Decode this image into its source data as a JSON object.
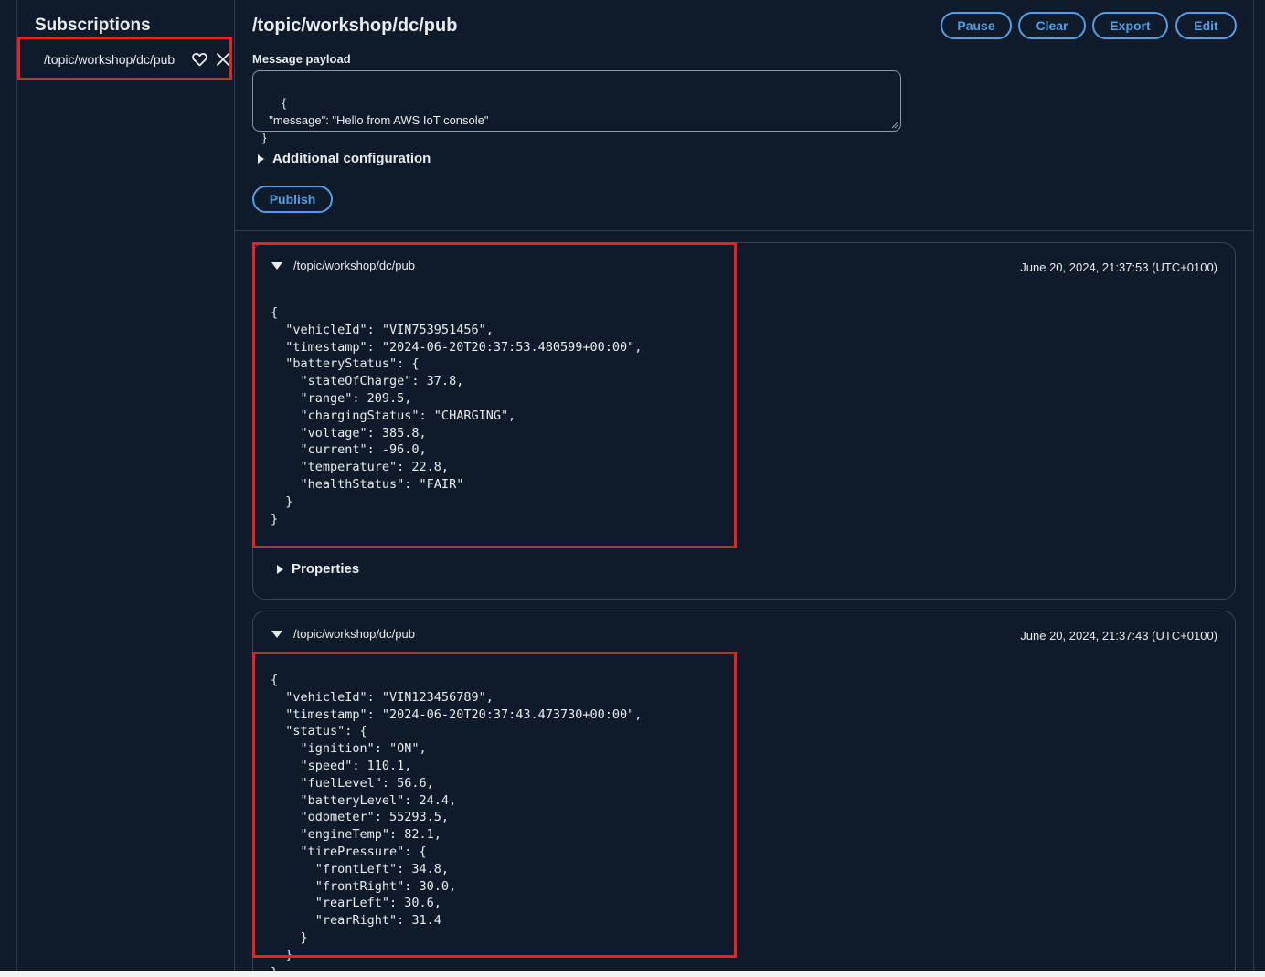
{
  "sidebar": {
    "title": "Subscriptions",
    "subscription": {
      "label": "/topic/workshop/dc/pub",
      "favorite_icon": "heart-icon",
      "close_icon": "close-icon"
    }
  },
  "main": {
    "title": "/topic/workshop/dc/pub",
    "toolbar": {
      "pause": "Pause",
      "clear": "Clear",
      "export": "Export",
      "edit": "Edit"
    },
    "payload_label": "Message payload",
    "payload_value": "{\n  \"message\": \"Hello from AWS IoT console\"\n}",
    "additional_config": "Additional configuration",
    "publish": "Publish"
  },
  "messages": [
    {
      "topic": "/topic/workshop/dc/pub",
      "time": "June 20, 2024, 21:37:53 (UTC+0100)",
      "body": "{\n  \"vehicleId\": \"VIN753951456\",\n  \"timestamp\": \"2024-06-20T20:37:53.480599+00:00\",\n  \"batteryStatus\": {\n    \"stateOfCharge\": 37.8,\n    \"range\": 209.5,\n    \"chargingStatus\": \"CHARGING\",\n    \"voltage\": 385.8,\n    \"current\": -96.0,\n    \"temperature\": 22.8,\n    \"healthStatus\": \"FAIR\"\n  }\n}",
      "properties": "Properties"
    },
    {
      "topic": "/topic/workshop/dc/pub",
      "time": "June 20, 2024, 21:37:43 (UTC+0100)",
      "body": "{\n  \"vehicleId\": \"VIN123456789\",\n  \"timestamp\": \"2024-06-20T20:37:43.473730+00:00\",\n  \"status\": {\n    \"ignition\": \"ON\",\n    \"speed\": 110.1,\n    \"fuelLevel\": 56.6,\n    \"batteryLevel\": 24.4,\n    \"odometer\": 55293.5,\n    \"engineTemp\": 82.1,\n    \"tirePressure\": {\n      \"frontLeft\": 34.8,\n      \"frontRight\": 30.0,\n      \"rearLeft\": 30.6,\n      \"rearRight\": 31.4\n    }\n  }\n}"
    }
  ],
  "colors": {
    "background": "#0f1b2a",
    "accent": "#539fe5",
    "highlight": "#e8231c"
  }
}
